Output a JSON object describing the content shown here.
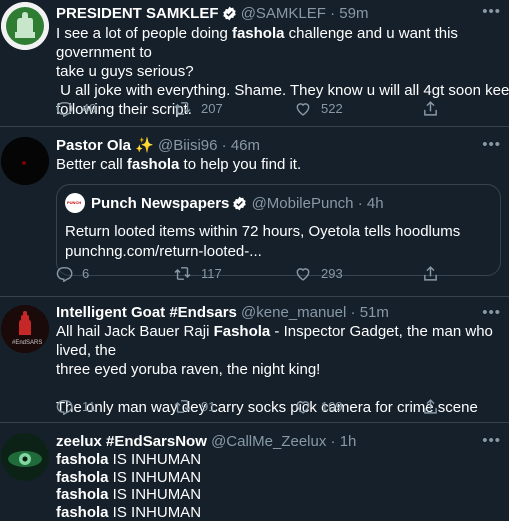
{
  "tweets": [
    {
      "name": "PRESIDENT SAMKLEF",
      "handle": "@SAMKLEF",
      "time": "59m",
      "lines": [
        {
          "pre": "I see a lot of people doing ",
          "bold": "fashola",
          "post": " challenge and u want this government to"
        },
        {
          "pre": "take u guys serious?",
          "bold": "",
          "post": ""
        },
        {
          "pre": " U all joke with everything. Shame. They know u will all 4gt soon keep",
          "bold": "",
          "post": ""
        },
        {
          "pre": "following their script.",
          "bold": "",
          "post": ""
        }
      ],
      "replies": "49",
      "retweets": "207",
      "likes": "522"
    },
    {
      "name": "Pastor Ola ✨",
      "handle": "@Biisi96",
      "time": "46m",
      "lines": [
        {
          "pre": "Better call ",
          "bold": "fashola",
          "post": " to help you find it."
        }
      ],
      "quote": {
        "avatar_text": "PUNCH",
        "name": "Punch Newspapers",
        "handle": "@MobilePunch",
        "time": "4h",
        "line1": "Return looted items within 72 hours, Oyetola tells hoodlums",
        "line2": "punchng.com/return-looted-..."
      },
      "replies": "6",
      "retweets": "117",
      "likes": "293"
    },
    {
      "name": "Intelligent Goat #Endsars",
      "handle": "@kene_manuel",
      "time": "51m",
      "avatar_text": "#EndSARS",
      "lines": [
        {
          "pre": "All hail Jack Bauer Raji ",
          "bold": "Fashola",
          "post": " - Inspector Gadget, the man who lived, the"
        },
        {
          "pre": "three eyed yoruba raven, the night king!",
          "bold": "",
          "post": ""
        },
        {
          "pre": "",
          "bold": "",
          "post": ""
        },
        {
          "pre": "The only man way dey carry socks pick camera for crime scene",
          "bold": "",
          "post": ""
        }
      ],
      "replies": "11",
      "retweets": "91",
      "likes": "109"
    },
    {
      "name": "zeelux #EndSarsNow",
      "handle": "@CallMe_Zeelux",
      "time": "1h",
      "lines": [
        {
          "pre": "",
          "bold": "fashola",
          "post": " IS INHUMAN"
        },
        {
          "pre": "",
          "bold": "fashola",
          "post": " IS INHUMAN"
        },
        {
          "pre": "",
          "bold": "fashola",
          "post": " IS INHUMAN"
        },
        {
          "pre": "",
          "bold": "fashola",
          "post": " IS INHUMAN"
        }
      ]
    }
  ],
  "icons": {
    "more": "more-horizontal-icon",
    "reply": "reply-icon",
    "retweet": "retweet-icon",
    "like": "heart-icon",
    "share": "share-icon",
    "verified": "verified-badge-icon"
  },
  "colors": {
    "background": "#15202b",
    "border": "#38444d",
    "muted": "#8899a6",
    "text": "#ffffff",
    "verified": "#ffffff"
  }
}
